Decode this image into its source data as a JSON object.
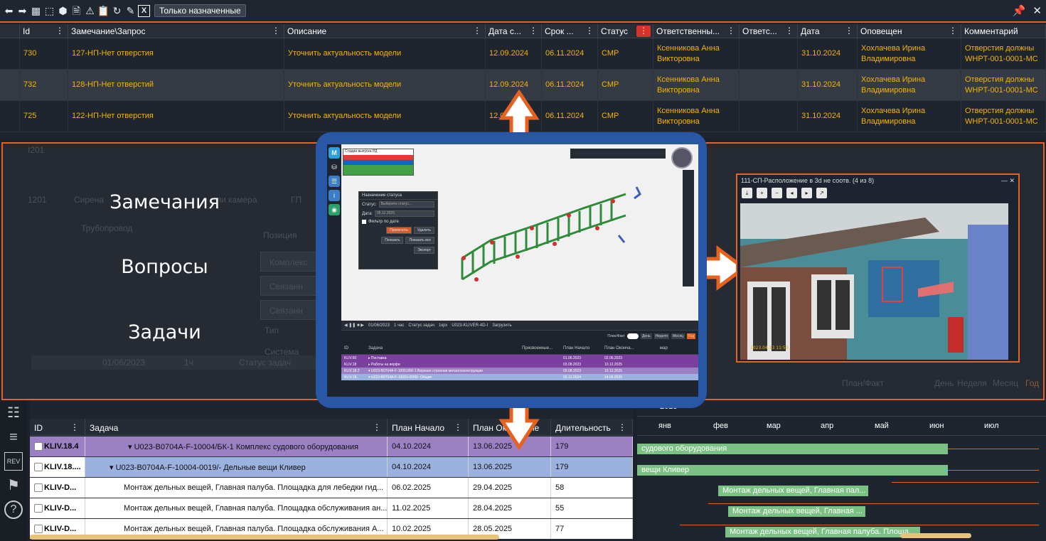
{
  "toolbar": {
    "assigned_only_label": "Только назначенные",
    "icons": [
      "arrow-left-icon",
      "arrow-right-icon",
      "grid-select-icon",
      "rect-select-icon",
      "cube-icon",
      "file-cog-icon",
      "warning-icon",
      "clipboard-user-icon",
      "refresh-icon",
      "edit-icon",
      "excel-icon"
    ]
  },
  "remarks_grid": {
    "columns": [
      "Id",
      "Замечание\\Запрос",
      "Описание",
      "Дата с...",
      "Срок ...",
      "Статус",
      "Ответственны...",
      "Ответс...",
      "Дата",
      "Оповещен",
      "Комментарий"
    ],
    "rows": [
      {
        "id": "730",
        "name": "127-НП-Нет отверстия",
        "desc": "Уточнить актуальность модели",
        "date_from": "12.09.2024",
        "due": "06.11.2024",
        "status": "СМР",
        "resp1": "Ксенникова Анна",
        "resp2": "Викторовна",
        "resp_b": "",
        "date": "31.10.2024",
        "notified1": "Хохлачева Ирина",
        "notified2": "Владимировна",
        "comment1": "Отверстия должны",
        "comment2": "WHPT-001-0001-МС"
      },
      {
        "id": "732",
        "name": "128-НП-Нет отверстий",
        "desc": "Уточнить актуальность модели",
        "date_from": "12.09.2024",
        "due": "06.11.2024",
        "status": "СМР",
        "resp1": "Ксенникова Анна",
        "resp2": "Викторовна",
        "resp_b": "",
        "date": "31.10.2024",
        "notified1": "Хохлачева Ирина",
        "notified2": "Владимировна",
        "comment1": "Отверстия должны",
        "comment2": "WHPT-001-0001-МС"
      },
      {
        "id": "725",
        "name": "122-НП-Нет отверстия",
        "desc": "Уточнить актуальность модели",
        "date_from": "12.09.2024",
        "due": "06.11.2024",
        "status": "СМР",
        "resp1": "Ксенникова Анна",
        "resp2": "Викторовна",
        "resp_b": "",
        "date": "31.10.2024",
        "notified1": "Хохлачева Ирина",
        "notified2": "Владимировна",
        "comment1": "Отверстия должны",
        "comment2": "WHPT-001-0001-МС"
      }
    ]
  },
  "overlay": {
    "word1": "Замечания",
    "word2": "Вопросы",
    "word3": "Задачи",
    "ghost_texts": [
      "Позиция",
      "Комплекс",
      "Связанн",
      "Связанн",
      "Тип",
      "Система",
      "01/06/2023",
      "1ч",
      "Статус задач",
      "План/Факт",
      "День",
      "Неделя",
      "Месяц",
      "Год",
      "Трубопровод",
      "Сирена",
      "ли камера",
      "ГП",
      "I201",
      "1201"
    ]
  },
  "tablet": {
    "legend_title": "Стадии выпуска РД",
    "legend_colors": [
      "#e53935",
      "#1565c0",
      "#43a047",
      "#43a047"
    ],
    "status_dialog": {
      "title": "Назначение статуса",
      "status_label": "Статус:",
      "status_placeholder": "Выберите статус...",
      "date_label": "Дата:",
      "date_value": "05.12.2025",
      "filter_label": "Фильтр по дате",
      "apply": "Применить",
      "delete": "Удалить",
      "show": "Показать",
      "show_all": "Показать все",
      "export": "Экспорт"
    },
    "gantt": {
      "date": "01/06/2023",
      "step": "1 час",
      "status": "Статус задач",
      "scale": "1крх",
      "model": "U023-KLIVER-4D-I",
      "load": "Загрузить",
      "plan_fact": "План/Факт",
      "views": [
        "День",
        "Неделя",
        "Месяц",
        "Год"
      ],
      "columns": [
        "ID",
        "Задача",
        "Присвоенные...",
        "План Начало",
        "План Оконча..."
      ],
      "month": "мар",
      "rows": [
        {
          "id": "KLIV.60",
          "task": "▸ Поставка",
          "start": "01.06.2023",
          "end": "02.06.2023",
          "color": "#7b3f9e"
        },
        {
          "id": "KLIV.18",
          "task": "▸ Работы на верфи",
          "start": "03.08.2023",
          "end": "10.12.2025",
          "color": "#7b3f9e"
        },
        {
          "id": "KLIV.18.2",
          "task": "▾ U023-B0704A-F-10001/БК-1 Верхнее строение металлоконструкции",
          "start": "03.08.2023",
          "end": "10.12.2025",
          "color": "#9b80c4"
        },
        {
          "id": "KLIV.18..",
          "task": "▾ U023-B0704A-F-10001-0009/- Общие",
          "start": "05.12.2024",
          "end": "14.06.2025",
          "color": "#9cb2de"
        }
      ]
    }
  },
  "photo_window": {
    "title": "111-СП-Расположение в 3d не соотв. (4 из 8)",
    "timestamp": "2023.04.13 11:53",
    "tools": [
      "download-icon",
      "zoom-in-icon",
      "zoom-out-icon",
      "prev-icon",
      "next-icon",
      "open-external-icon"
    ]
  },
  "task_table": {
    "columns": [
      "ID",
      "Задача",
      "План Начало",
      "План Окончание",
      "Длительность"
    ],
    "rows": [
      {
        "id": "KLIV.18.4",
        "task": "▾ U023-B0704A-F-10004/БК-1 Комплекс судового оборудования",
        "start": "04.10.2024",
        "end": "13.06.2025",
        "duration": "179",
        "style": "l1"
      },
      {
        "id": "KLIV.18....",
        "task": "▾ U023-B0704A-F-10004-0019/- Дельные вещи Кливер",
        "start": "04.10.2024",
        "end": "13.06.2025",
        "duration": "179",
        "style": "l2"
      },
      {
        "id": "KLIV-D...",
        "task": "Монтаж дельных вещей, Главная палуба. Площадка для лебедки гид...",
        "start": "06.02.2025",
        "end": "29.04.2025",
        "duration": "58",
        "style": "l3"
      },
      {
        "id": "KLIV-D...",
        "task": "Монтаж дельных вещей, Главная палуба. Площадка обслуживания ан...",
        "start": "11.02.2025",
        "end": "28.04.2025",
        "duration": "55",
        "style": "l3"
      },
      {
        "id": "KLIV-D...",
        "task": "Монтаж дельных вещей, Главная палуба. Площадка обслуживания А...",
        "start": "10.02.2025",
        "end": "28.05.2025",
        "duration": "77",
        "style": "l3"
      }
    ]
  },
  "gantt": {
    "year": "2025",
    "months": [
      "янв",
      "фев",
      "мар",
      "апр",
      "май",
      "июн",
      "июл"
    ],
    "bars": [
      "судового оборудования",
      "вещи Кливер",
      "Монтаж дельных вещей, Главная пал...",
      "Монтаж дельных вещей, Главная ...",
      "Монтаж дельных вещей, Главная палуба. Площа..."
    ]
  },
  "colors": {
    "accent": "#e8621f",
    "remark_text": "#f4b400",
    "status_red": "#d9322b",
    "level1": "#9b80c4",
    "level2": "#9cb2de",
    "gantt_bar": "#7cc184",
    "tablet_frame": "#2857a6"
  }
}
